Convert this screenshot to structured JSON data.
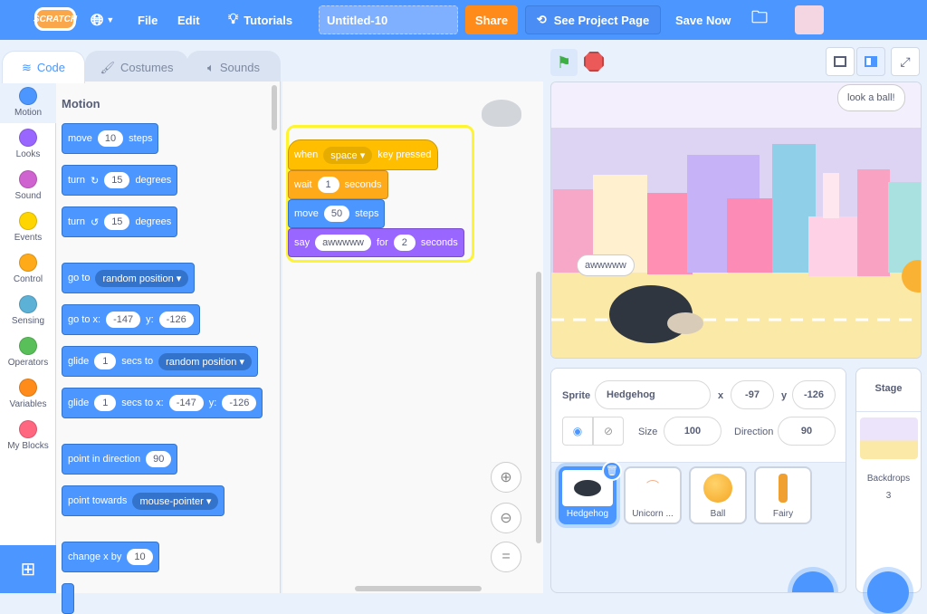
{
  "header": {
    "logo": "SCRATCH",
    "menu": [
      "File",
      "Edit"
    ],
    "tutorials": "Tutorials",
    "project_title": "Untitled-10",
    "share": "Share",
    "see_project_page": "See Project Page",
    "save_now": "Save Now",
    "brand_color": "#4c97ff"
  },
  "tabs": [
    {
      "label": "Code",
      "active": true
    },
    {
      "label": "Costumes"
    },
    {
      "label": "Sounds"
    }
  ],
  "categories": [
    {
      "label": "Motion",
      "color": "#4c97ff"
    },
    {
      "label": "Looks",
      "color": "#9966ff"
    },
    {
      "label": "Sound",
      "color": "#cf63cf"
    },
    {
      "label": "Events",
      "color": "#ffd500"
    },
    {
      "label": "Control",
      "color": "#ffab19"
    },
    {
      "label": "Sensing",
      "color": "#5cb1d6"
    },
    {
      "label": "Operators",
      "color": "#59c059"
    },
    {
      "label": "Variables",
      "color": "#ff8c1a"
    },
    {
      "label": "My Blocks",
      "color": "#ff6680"
    }
  ],
  "palette": {
    "heading": "Motion",
    "blocks": {
      "move": {
        "a": "move",
        "v": "10",
        "b": "steps"
      },
      "turn_r": {
        "a": "turn",
        "v": "15",
        "b": "degrees"
      },
      "turn_l": {
        "a": "turn",
        "v": "15",
        "b": "degrees"
      },
      "goto": {
        "a": "go to",
        "d": "random position"
      },
      "gotoxy": {
        "a": "go to x:",
        "x": "-147",
        "y_label": "y:",
        "y": "-126"
      },
      "glide": {
        "a": "glide",
        "v": "1",
        "b": "secs to",
        "d": "random position"
      },
      "glidexy": {
        "a": "glide",
        "v": "1",
        "b": "secs to x:",
        "x": "-147",
        "y_label": "y:",
        "y": "-126"
      },
      "point": {
        "a": "point in direction",
        "v": "90"
      },
      "towards": {
        "a": "point towards",
        "d": "mouse-pointer"
      },
      "changex": {
        "a": "change x by",
        "v": "10"
      }
    }
  },
  "script": {
    "when": {
      "a": "when",
      "d": "space",
      "b": "key pressed"
    },
    "wait": {
      "a": "wait",
      "v": "1",
      "b": "seconds"
    },
    "move": {
      "a": "move",
      "v": "50",
      "b": "steps"
    },
    "say": {
      "a": "say",
      "v": "awwwww",
      "b": "for",
      "v2": "2",
      "c": "seconds"
    }
  },
  "stage": {
    "bubble_top": "look a  ball!",
    "bubble_hedgehog": "awwwww"
  },
  "sprite_info": {
    "sprite_label": "Sprite",
    "name": "Hedgehog",
    "x_label": "x",
    "x": "-97",
    "y_label": "y",
    "y": "-126",
    "size_label": "Size",
    "size": "100",
    "direction_label": "Direction",
    "direction": "90"
  },
  "sprites": [
    {
      "name": "Hedgehog",
      "selected": true
    },
    {
      "name": "Unicorn ..."
    },
    {
      "name": "Ball"
    },
    {
      "name": "Fairy"
    }
  ],
  "stage_pane": {
    "title": "Stage",
    "backdrops_label": "Backdrops",
    "backdrops_count": "3"
  }
}
